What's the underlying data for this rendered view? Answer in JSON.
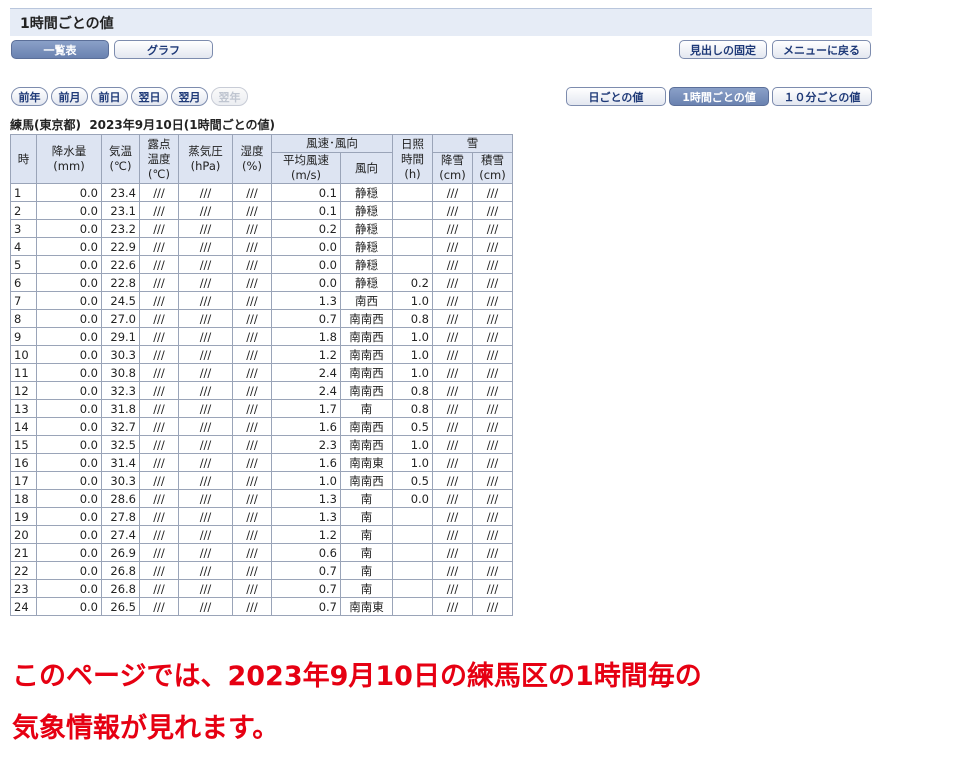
{
  "page_title": "1時間ごとの値",
  "tabs": [
    "一覧表",
    "グラフ"
  ],
  "header_buttons": [
    "見出しの固定",
    "メニューに戻る"
  ],
  "nav_buttons": [
    "前年",
    "前月",
    "前日",
    "翌日",
    "翌月",
    "翌年"
  ],
  "interval_buttons": [
    "日ごとの値",
    "1時間ごとの値",
    "１０分ごとの値"
  ],
  "station_title": "練馬(東京都)  2023年9月10日(1時間ごとの値)",
  "table": {
    "h_hour": "時",
    "h_precip": [
      "降水量",
      "(mm)"
    ],
    "h_temp": [
      "気温",
      "(℃)"
    ],
    "h_dew": [
      "露点",
      "温度",
      "(℃)"
    ],
    "h_vapor": [
      "蒸気圧",
      "(hPa)"
    ],
    "h_humid": [
      "湿度",
      "(%)"
    ],
    "h_wind": "風速･風向",
    "h_wind_speed": [
      "平均風速",
      "(m/s)"
    ],
    "h_wind_dir": "風向",
    "h_sun": [
      "日照",
      "時間",
      "(h)"
    ],
    "h_snow": "雪",
    "h_snowfall": [
      "降雪",
      "(cm)"
    ],
    "h_snowdepth": [
      "積雪",
      "(cm)"
    ],
    "rows": [
      [
        "1",
        "0.0",
        "23.4",
        "///",
        "///",
        "///",
        "0.1",
        "静穏",
        "",
        "///",
        "///"
      ],
      [
        "2",
        "0.0",
        "23.1",
        "///",
        "///",
        "///",
        "0.1",
        "静穏",
        "",
        "///",
        "///"
      ],
      [
        "3",
        "0.0",
        "23.2",
        "///",
        "///",
        "///",
        "0.2",
        "静穏",
        "",
        "///",
        "///"
      ],
      [
        "4",
        "0.0",
        "22.9",
        "///",
        "///",
        "///",
        "0.0",
        "静穏",
        "",
        "///",
        "///"
      ],
      [
        "5",
        "0.0",
        "22.6",
        "///",
        "///",
        "///",
        "0.0",
        "静穏",
        "",
        "///",
        "///"
      ],
      [
        "6",
        "0.0",
        "22.8",
        "///",
        "///",
        "///",
        "0.0",
        "静穏",
        "0.2",
        "///",
        "///"
      ],
      [
        "7",
        "0.0",
        "24.5",
        "///",
        "///",
        "///",
        "1.3",
        "南西",
        "1.0",
        "///",
        "///"
      ],
      [
        "8",
        "0.0",
        "27.0",
        "///",
        "///",
        "///",
        "0.7",
        "南南西",
        "0.8",
        "///",
        "///"
      ],
      [
        "9",
        "0.0",
        "29.1",
        "///",
        "///",
        "///",
        "1.8",
        "南南西",
        "1.0",
        "///",
        "///"
      ],
      [
        "10",
        "0.0",
        "30.3",
        "///",
        "///",
        "///",
        "1.2",
        "南南西",
        "1.0",
        "///",
        "///"
      ],
      [
        "11",
        "0.0",
        "30.8",
        "///",
        "///",
        "///",
        "2.4",
        "南南西",
        "1.0",
        "///",
        "///"
      ],
      [
        "12",
        "0.0",
        "32.3",
        "///",
        "///",
        "///",
        "2.4",
        "南南西",
        "0.8",
        "///",
        "///"
      ],
      [
        "13",
        "0.0",
        "31.8",
        "///",
        "///",
        "///",
        "1.7",
        "南",
        "0.8",
        "///",
        "///"
      ],
      [
        "14",
        "0.0",
        "32.7",
        "///",
        "///",
        "///",
        "1.6",
        "南南西",
        "0.5",
        "///",
        "///"
      ],
      [
        "15",
        "0.0",
        "32.5",
        "///",
        "///",
        "///",
        "2.3",
        "南南西",
        "1.0",
        "///",
        "///"
      ],
      [
        "16",
        "0.0",
        "31.4",
        "///",
        "///",
        "///",
        "1.6",
        "南南東",
        "1.0",
        "///",
        "///"
      ],
      [
        "17",
        "0.0",
        "30.3",
        "///",
        "///",
        "///",
        "1.0",
        "南南西",
        "0.5",
        "///",
        "///"
      ],
      [
        "18",
        "0.0",
        "28.6",
        "///",
        "///",
        "///",
        "1.3",
        "南",
        "0.0",
        "///",
        "///"
      ],
      [
        "19",
        "0.0",
        "27.8",
        "///",
        "///",
        "///",
        "1.3",
        "南",
        "",
        "///",
        "///"
      ],
      [
        "20",
        "0.0",
        "27.4",
        "///",
        "///",
        "///",
        "1.2",
        "南",
        "",
        "///",
        "///"
      ],
      [
        "21",
        "0.0",
        "26.9",
        "///",
        "///",
        "///",
        "0.6",
        "南",
        "",
        "///",
        "///"
      ],
      [
        "22",
        "0.0",
        "26.8",
        "///",
        "///",
        "///",
        "0.7",
        "南",
        "",
        "///",
        "///"
      ],
      [
        "23",
        "0.0",
        "26.8",
        "///",
        "///",
        "///",
        "0.7",
        "南",
        "",
        "///",
        "///"
      ],
      [
        "24",
        "0.0",
        "26.5",
        "///",
        "///",
        "///",
        "0.7",
        "南南東",
        "",
        "///",
        "///"
      ]
    ]
  },
  "annotation": [
    "このページでは、2023年9月10日の練馬区の1時間毎の",
    "気象情報が見れます。"
  ],
  "colors": {
    "annotation": "#e60012",
    "header_bg": "#dde4f2",
    "button_text": "#1f3a78",
    "selected_button": "#7b91bd"
  }
}
